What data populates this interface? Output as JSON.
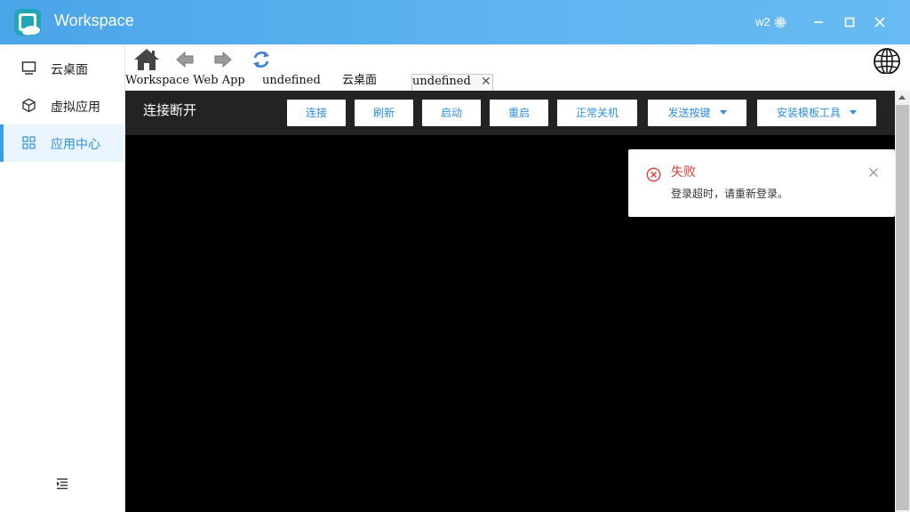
{
  "window": {
    "title": "Workspace",
    "user": "w2"
  },
  "sidebar": {
    "items": [
      {
        "label": "云桌面",
        "icon": "monitor-icon",
        "active": false
      },
      {
        "label": "虚拟应用",
        "icon": "cube-icon",
        "active": false
      },
      {
        "label": "应用中心",
        "icon": "grid-icon",
        "active": true
      }
    ]
  },
  "tabs": [
    {
      "label": "Workspace Web App"
    },
    {
      "label": "undefined"
    },
    {
      "label": "云桌面"
    },
    {
      "label": "undefined",
      "selected": true
    }
  ],
  "session": {
    "status": "连接断开",
    "buttons": [
      {
        "label": "连接"
      },
      {
        "label": "刷新"
      },
      {
        "label": "启动"
      },
      {
        "label": "重启"
      },
      {
        "label": "正常关机"
      },
      {
        "label": "发送按键",
        "dropdown": true
      },
      {
        "label": "安装模板工具",
        "dropdown": true
      }
    ]
  },
  "toast": {
    "title": "失败",
    "message": "登录超时，请重新登录。"
  },
  "colors": {
    "accent": "#2d8fe0",
    "error": "#e0413a",
    "titlebar": "#5fb5f0"
  }
}
